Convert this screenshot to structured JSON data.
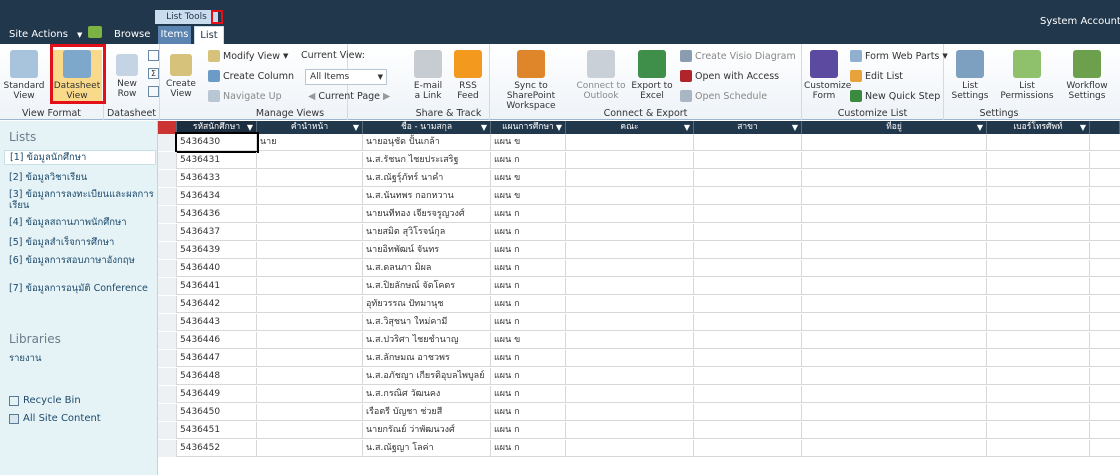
{
  "topbar": {
    "site_actions": "Site Actions",
    "browse": "Browse",
    "list_tools": "List Tools",
    "tab_items": "Items",
    "tab_list": "List",
    "user": "System Account"
  },
  "ribbon": {
    "view_format": {
      "label": "View Format",
      "standard": "Standard View",
      "datasheet": "Datasheet View"
    },
    "datasheet": {
      "label": "Datasheet",
      "new_row": "New Row"
    },
    "manage_views": {
      "label": "Manage Views",
      "create_view": "Create View",
      "modify_view": "Modify View",
      "create_column": "Create Column",
      "navigate_up": "Navigate Up",
      "current_view_label": "Current View:",
      "current_view_value": "All Items",
      "current_page": "Current Page"
    },
    "share_track": {
      "label": "Share & Track",
      "email_link": "E-mail a Link",
      "rss_feed": "RSS Feed"
    },
    "connect_export": {
      "label": "Connect & Export",
      "sync_sharepoint": "Sync to SharePoint Workspace",
      "connect_outlook": "Connect to Outlook",
      "export_excel": "Export to Excel",
      "create_visio": "Create Visio Diagram",
      "open_access": "Open with Access",
      "open_schedule": "Open Schedule"
    },
    "customize_list": {
      "label": "Customize List",
      "customize_form": "Customize Form",
      "form_web_parts": "Form Web Parts",
      "edit_list": "Edit List",
      "new_quick_step": "New Quick Step"
    },
    "settings": {
      "label": "Settings",
      "list_settings": "List Settings",
      "list_permissions": "List Permissions",
      "workflow_settings": "Workflow Settings"
    }
  },
  "nav": {
    "lists_heading": "Lists",
    "items": [
      "[1] ข้อมูลนักศึกษา",
      "[2] ข้อมูลวิชาเรียน",
      "[3] ข้อมูลการลงทะเบียนและผลการเรียน",
      "[4] ข้อมูลสถานภาพนักศึกษา",
      "[5] ข้อมูลสำเร็จการศึกษา",
      "[6] ข้อมูลการสอบภาษาอังกฤษ",
      "[7] ข้อมูลการอนุมัติ Conference"
    ],
    "libraries_heading": "Libraries",
    "libraries_item": "รายงาน",
    "recycle_bin": "Recycle Bin",
    "all_site_content": "All Site Content"
  },
  "grid": {
    "headers": [
      "รหัสนักศึกษา",
      "คำนำหน้า",
      "ชื่อ - นามสกุล",
      "แผนการศึกษา",
      "คณะ",
      "สาขา",
      "ที่อยู่",
      "เบอร์โทรศัพท์"
    ],
    "rows": [
      [
        "5436430",
        "นาย",
        "นายอนุชัด ปั้นเกล้า",
        "แผน ข"
      ],
      [
        "5436431",
        "",
        "น.ส.รัชนก ไชยประเสริฐ",
        "แผน ก"
      ],
      [
        "5436433",
        "",
        "น.ส.ณัฐรุ์ภัทร์ นาคำ",
        "แผน ข"
      ],
      [
        "5436434",
        "",
        "น.ส.นันทพร กอกหวาน",
        "แผน ข"
      ],
      [
        "5436436",
        "",
        "นายนทีทอง เจียรจรูญวงศ์",
        "แผน ก"
      ],
      [
        "5436437",
        "",
        "นายสมิต สุวิโรจน์กุล",
        "แผน ก"
      ],
      [
        "5436439",
        "",
        "นายอิทพัฒน์ จันทร",
        "แผน ก"
      ],
      [
        "5436440",
        "",
        "น.ส.ดลนภา มิผล",
        "แผน ก"
      ],
      [
        "5436441",
        "",
        "น.ส.ปิยลักษณ์ จัดโคตร",
        "แผน ก"
      ],
      [
        "5436442",
        "",
        "อุทัยวรรณ ปัทมานุช",
        "แผน ก"
      ],
      [
        "5436443",
        "",
        "น.ส.วิสุชนา ใหม่คามี",
        "แผน ก"
      ],
      [
        "5436446",
        "",
        "น.ส.ปวริศา ไชยชำนาญ",
        "แผน ข"
      ],
      [
        "5436447",
        "",
        "น.ส.ลักษมณ อาชวพร",
        "แผน ก"
      ],
      [
        "5436448",
        "",
        "น.ส.อภัชญา เกียรติอุบลไพบูลย์",
        "แผน ก"
      ],
      [
        "5436449",
        "",
        "น.ส.กรณิศ วัฒนคง",
        "แผน ก"
      ],
      [
        "5436450",
        "",
        "เรือตรี บัญชา ช่วยสี",
        "แผน ก"
      ],
      [
        "5436451",
        "",
        "นายกรัณย์ ว่าพัฒนวงศ์",
        "แผน ก"
      ],
      [
        "5436452",
        "",
        "น.ส.ณัฐญา โลค่า",
        "แผน ก"
      ]
    ]
  }
}
